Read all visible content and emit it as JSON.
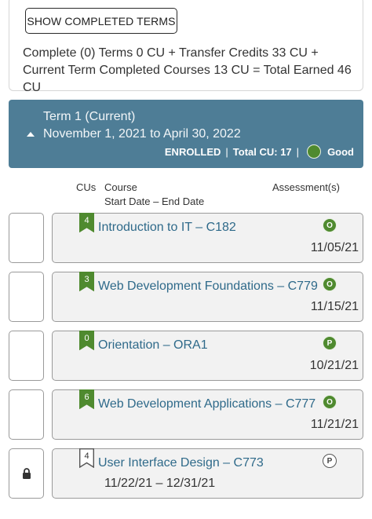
{
  "summary": {
    "show_completed_label": "SHOW COMPLETED TERMS",
    "text": "Complete (0) Terms 0 CU + Transfer Credits 33 CU + Current Term Completed Courses 13 CU = Total Earned 46 CU"
  },
  "term": {
    "title": "Term 1 (Current)",
    "dates": "November 1, 2021 to April 30, 2022",
    "status": "ENROLLED",
    "total_cu": "Total CU: 17",
    "health_label": "Good",
    "health_color": "#4f8a2f"
  },
  "columns": {
    "cus": "CUs",
    "course": "Course",
    "dates": "Start Date – End Date",
    "assessment": "Assessment(s)"
  },
  "courses": [
    {
      "cu": "4",
      "title": "Introduction to IT – C182",
      "badge": "O",
      "date": "11/05/21",
      "flag_style": "filled",
      "badge_style": "filled"
    },
    {
      "cu": "3",
      "title": "Web Development Foundations – C779",
      "badge": "O",
      "date": "11/15/21",
      "flag_style": "filled",
      "badge_style": "filled"
    },
    {
      "cu": "0",
      "title": "Orientation – ORA1",
      "badge": "P",
      "date": "10/21/21",
      "flag_style": "filled",
      "badge_style": "filled"
    },
    {
      "cu": "6",
      "title": "Web Development Applications – C777",
      "badge": "O",
      "date": "11/21/21",
      "flag_style": "filled",
      "badge_style": "filled"
    },
    {
      "cu": "4",
      "title": "User Interface Design – C773",
      "badge": "P",
      "date_range": "11/22/21 – 12/31/21",
      "flag_style": "outline",
      "badge_style": "outline"
    }
  ],
  "colors": {
    "term_header": "#4e7d96",
    "course_link": "#2f6a8a",
    "flag_green": "#4f8a2f",
    "badge_green": "#4f8a2f"
  },
  "icons": {
    "term_caret": "caret-up-icon",
    "locked_row": "lock-icon"
  }
}
